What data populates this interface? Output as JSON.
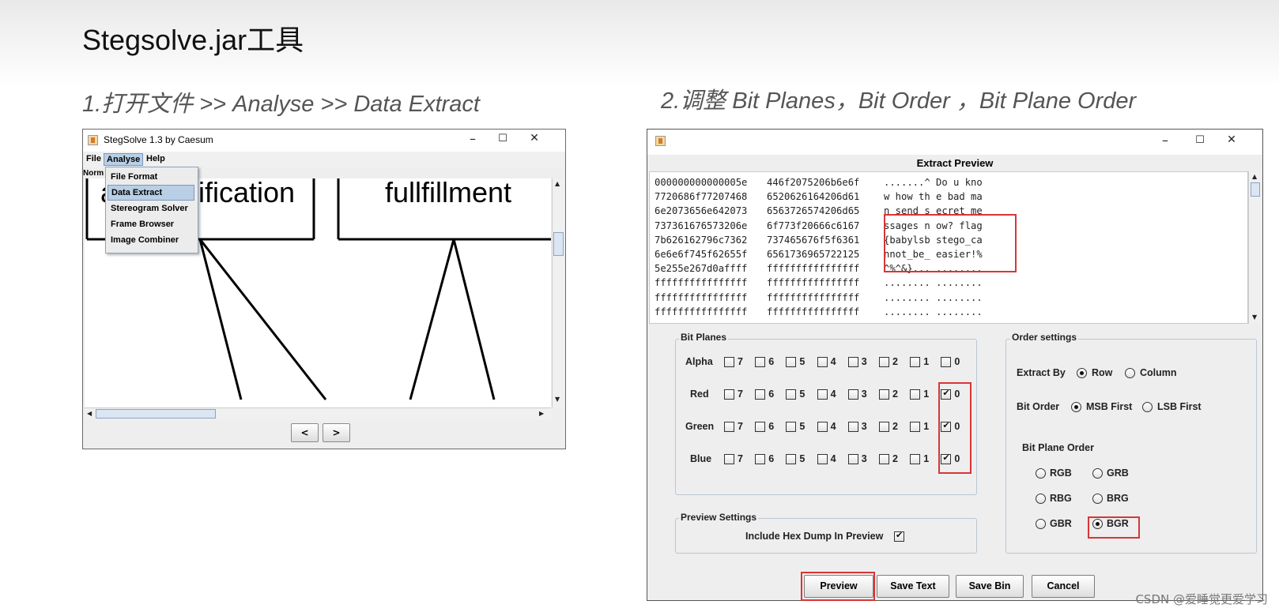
{
  "page": {
    "title": "Stegsolve.jar工具",
    "step1": "1.打开文件 >> Analyse >> Data Extract",
    "step2": "2.调整 Bit Planes，Bit Order ，Bit Plane Order",
    "watermark": "CSDN @爱睡觉更爱学习"
  },
  "left_window": {
    "title": "StegSolve 1.3 by Caesum",
    "controls": {
      "minimize": "–",
      "maximize": "☐",
      "close": "✕"
    },
    "menu": [
      "File",
      "Analyse",
      "Help"
    ],
    "active_menu": "Analyse",
    "mode_label": "Norm",
    "dropdown": [
      "File Format",
      "Data Extract",
      "Stereogram Solver",
      "Frame Browser",
      "Image Combiner"
    ],
    "selected_item": "Data Extract",
    "canvas_text": {
      "left": "a",
      "middle": "lification",
      "right": "fullfillment"
    },
    "nav": {
      "prev": "<",
      "next": ">"
    }
  },
  "right_window": {
    "controls": {
      "minimize": "–",
      "maximize": "☐",
      "close": "✕"
    },
    "preview_title": "Extract Preview",
    "hex_rows": [
      [
        "000000000000005e",
        "446f2075206b6e6f",
        ".......^ Do u kno"
      ],
      [
        "7720686f77207468",
        "6520626164206d61",
        "w how th e bad ma"
      ],
      [
        "6e2073656e642073",
        "6563726574206d65",
        "n send s ecret me"
      ],
      [
        "737361676573206e",
        "6f773f20666c6167",
        "ssages n ow? flag"
      ],
      [
        "7b626162796c7362",
        "737465676f5f6361",
        "{babylsb stego_ca"
      ],
      [
        "6e6e6f745f62655f",
        "6561736965722125",
        "nnot_be_ easier!%"
      ],
      [
        "5e255e267d0affff",
        "ffffffffffffffff",
        "^%^&}... ........"
      ],
      [
        "ffffffffffffffff",
        "ffffffffffffffff",
        "........ ........"
      ],
      [
        "ffffffffffffffff",
        "ffffffffffffffff",
        "........ ........"
      ],
      [
        "ffffffffffffffff",
        "ffffffffffffffff",
        "........ ........"
      ]
    ],
    "bit_planes": {
      "legend": "Bit Planes",
      "rows": [
        {
          "label": "Alpha",
          "checked": []
        },
        {
          "label": "Red",
          "checked": [
            "0"
          ]
        },
        {
          "label": "Green",
          "checked": [
            "0"
          ]
        },
        {
          "label": "Blue",
          "checked": [
            "0"
          ]
        }
      ],
      "bits": [
        "7",
        "6",
        "5",
        "4",
        "3",
        "2",
        "1",
        "0"
      ]
    },
    "preview_settings": {
      "legend": "Preview Settings",
      "hex_dump_label": "Include Hex Dump In Preview",
      "hex_dump_checked": true
    },
    "order_settings": {
      "legend": "Order settings",
      "extract_by_label": "Extract By",
      "extract_by_options": [
        "Row",
        "Column"
      ],
      "extract_by_selected": "Row",
      "bit_order_label": "Bit Order",
      "bit_order_options": [
        "MSB First",
        "LSB First"
      ],
      "bit_order_selected": "MSB First",
      "plane_order_label": "Bit Plane Order",
      "plane_order_options": [
        "RGB",
        "GRB",
        "RBG",
        "BRG",
        "GBR",
        "BGR"
      ],
      "plane_order_selected": "BGR"
    },
    "buttons": [
      "Preview",
      "Save Text",
      "Save Bin",
      "Cancel"
    ],
    "highlight_color": "#d83535"
  }
}
